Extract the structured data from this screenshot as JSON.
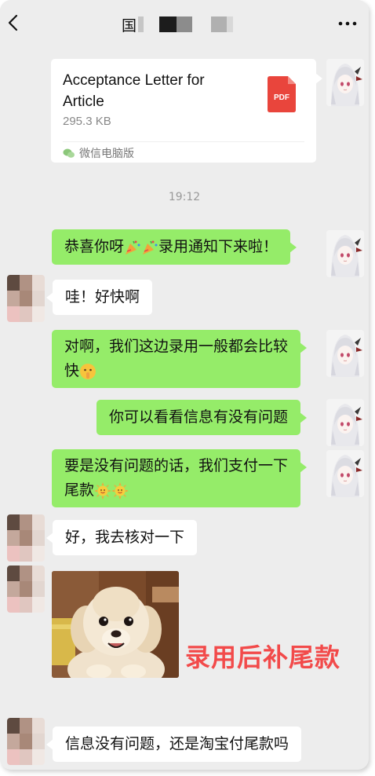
{
  "topbar": {
    "title_char": "国",
    "back_icon": "chevron-left-icon",
    "more_icon": "ellipsis-icon"
  },
  "file_message": {
    "file_name_line1": "Acceptance Letter for",
    "file_name_line2": "Article",
    "file_size": "295.3 KB",
    "file_type": "PDF",
    "source": "微信电脑版",
    "colors": {
      "pdf": "#e9453c"
    }
  },
  "timestamp": "19:12",
  "messages": [
    {
      "side": "me",
      "text": "恭喜你呀",
      "tail": "录用通知下来啦！"
    },
    {
      "side": "other",
      "text": "哇！好快啊"
    },
    {
      "side": "me",
      "line1": "对啊，我们这边录用一般都会比较",
      "line2": "快"
    },
    {
      "side": "me",
      "text": "你可以看看信息有没有问题"
    },
    {
      "side": "me",
      "line1": "要是没有问题的话，我们支付一下",
      "line2": "尾款"
    },
    {
      "side": "other",
      "text": "好，我去核对一下"
    },
    {
      "side": "other",
      "type": "sticker",
      "icon": "puppy-sticker-icon"
    },
    {
      "side": "other",
      "text": "信息没有问题，还是淘宝付尾款吗"
    }
  ],
  "overlay": "录用后补尾款",
  "colors": {
    "green_bubble": "#95ec69",
    "background": "#ededed",
    "overlay": "#f24a4a"
  }
}
